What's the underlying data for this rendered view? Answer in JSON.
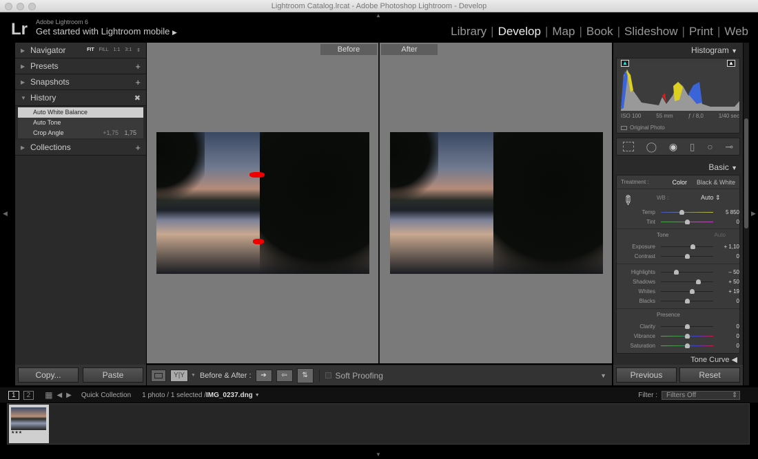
{
  "window": {
    "title": "Lightroom Catalog.lrcat - Adobe Photoshop Lightroom - Develop"
  },
  "header": {
    "logo": "Lr",
    "product": "Adobe Lightroom 6",
    "mobile": "Get started with Lightroom mobile",
    "modules": [
      "Library",
      "Develop",
      "Map",
      "Book",
      "Slideshow",
      "Print",
      "Web"
    ],
    "active": "Develop"
  },
  "left": {
    "navigator": {
      "label": "Navigator",
      "zoom": [
        "FIT",
        "FILL",
        "1:1",
        "3:1"
      ]
    },
    "presets": "Presets",
    "snapshots": "Snapshots",
    "history": "History",
    "history_items": [
      {
        "label": "Auto White Balance",
        "selected": true
      },
      {
        "label": "Auto Tone"
      },
      {
        "label": "Crop Angle",
        "from": "+1,75",
        "to": "1,75"
      }
    ],
    "collections": "Collections",
    "copy": "Copy...",
    "paste": "Paste"
  },
  "center": {
    "before": "Before",
    "after": "After"
  },
  "toolbar": {
    "yy": "Y|Y",
    "before_after": "Before & After :",
    "soft_proofing": "Soft Proofing"
  },
  "right": {
    "histogram": "Histogram",
    "iso": "ISO 100",
    "focal": "55 mm",
    "aperture": "ƒ / 8,0",
    "shutter": "1/40 sec",
    "original_photo": "Original Photo",
    "basic": "Basic",
    "treatment_label": "Treatment :",
    "treatment_color": "Color",
    "treatment_bw": "Black & White",
    "wb_label": "WB :",
    "wb_value": "Auto",
    "wb_sliders": [
      {
        "label": "Temp",
        "value": "5 850",
        "level": 0.4
      },
      {
        "label": "Tint",
        "value": "0",
        "level": 0.5
      }
    ],
    "tone_label": "Tone",
    "auto": "Auto",
    "tone_sliders": [
      {
        "label": "Exposure",
        "value": "+ 1,10",
        "level": 0.61
      },
      {
        "label": "Contrast",
        "value": "0",
        "level": 0.5
      }
    ],
    "tone2_sliders": [
      {
        "label": "Highlights",
        "value": "– 50",
        "level": 0.29
      },
      {
        "label": "Shadows",
        "value": "+ 50",
        "level": 0.71
      },
      {
        "label": "Whites",
        "value": "+ 19",
        "level": 0.59
      },
      {
        "label": "Blacks",
        "value": "0",
        "level": 0.5
      }
    ],
    "presence_label": "Presence",
    "presence_sliders": [
      {
        "label": "Clarity",
        "value": "0",
        "level": 0.5
      },
      {
        "label": "Vibrance",
        "value": "0",
        "level": 0.5
      },
      {
        "label": "Saturation",
        "value": "0",
        "level": 0.5
      }
    ],
    "tone_curve": "Tone Curve",
    "previous": "Previous",
    "reset": "Reset"
  },
  "filmstrip": {
    "screen1": "1",
    "screen2": "2",
    "source": "Quick Collection",
    "count": "1 photo / 1 selected /",
    "filename": "IMG_0237.dng",
    "filter_label": "Filter :",
    "filter_value": "Filters Off",
    "rating": "★★★"
  }
}
